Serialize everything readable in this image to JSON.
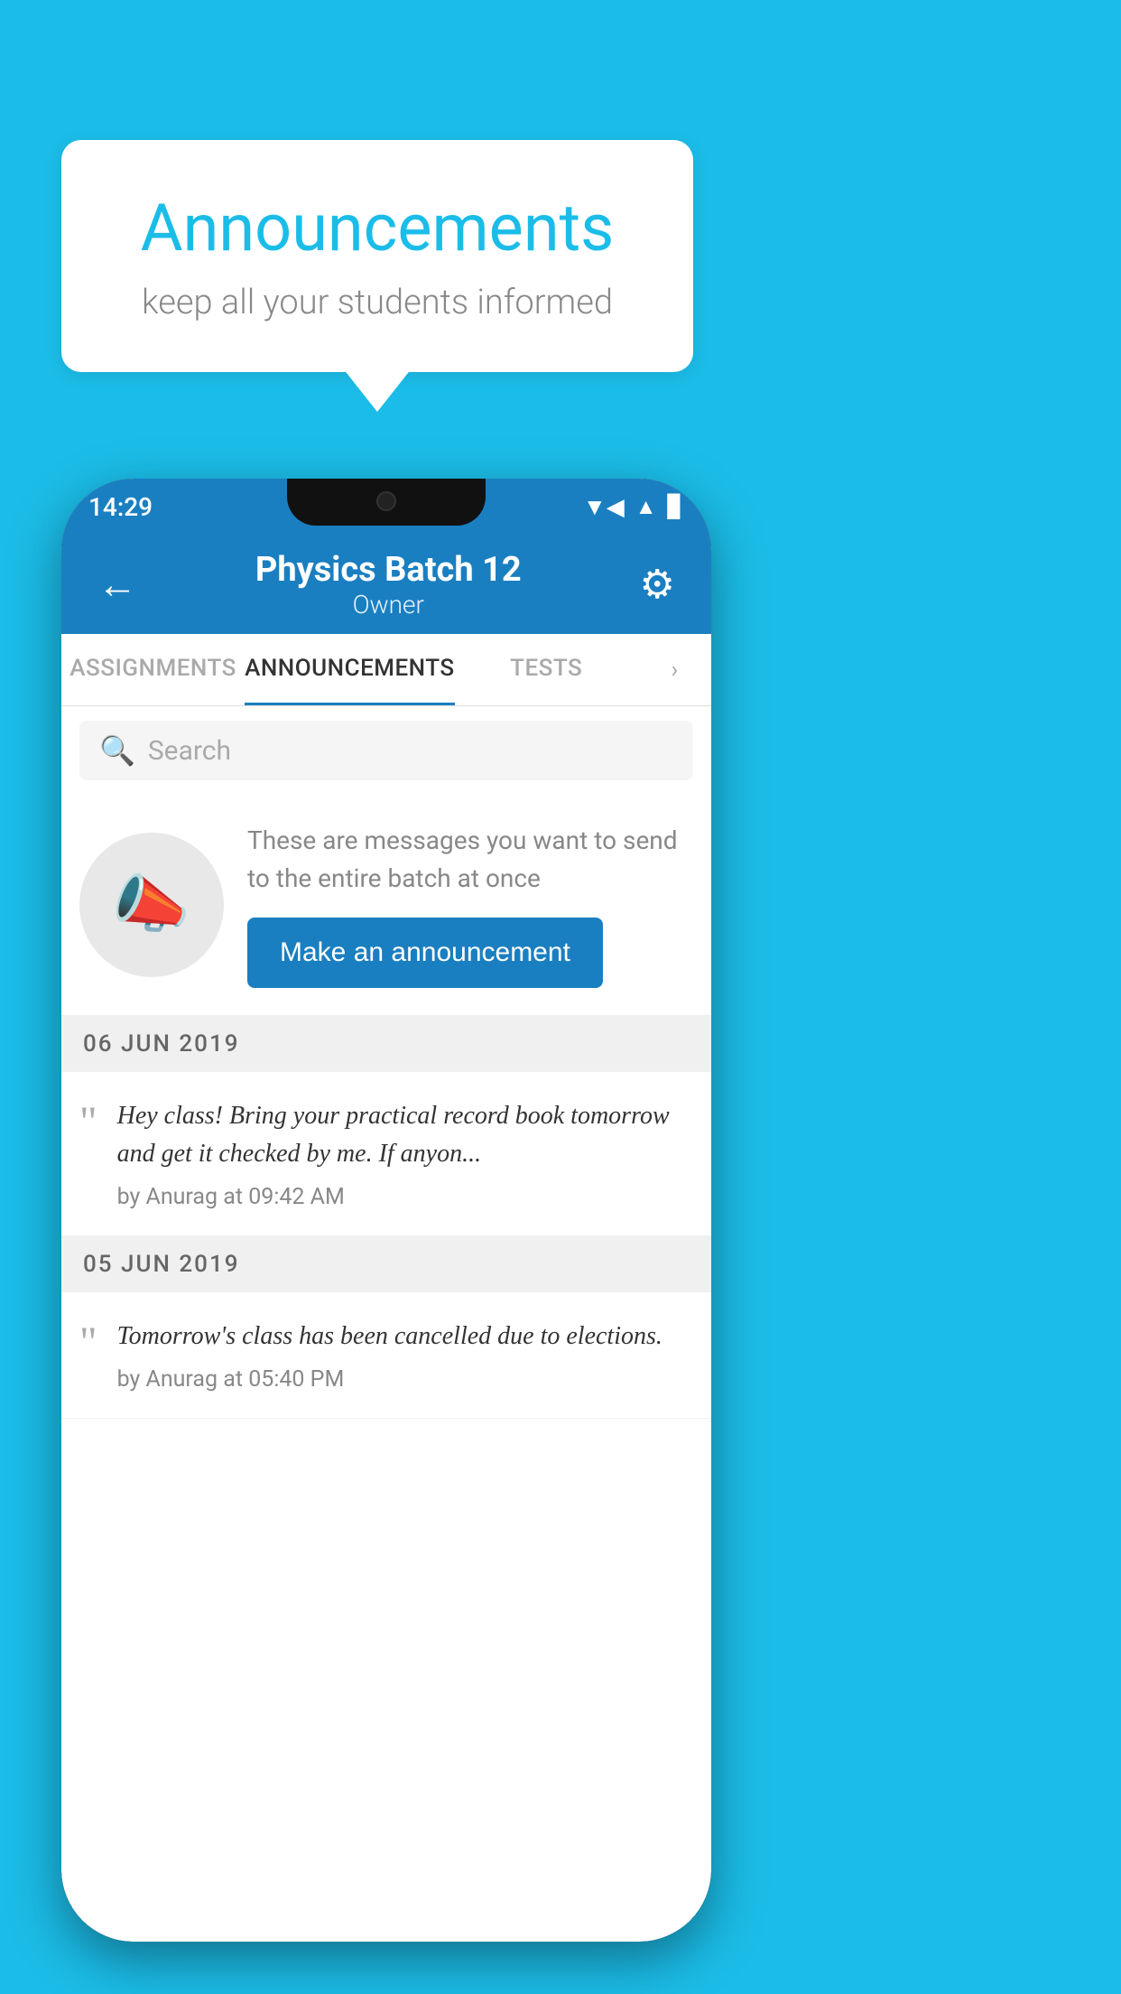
{
  "page": {
    "background_color": "#1BBDE8"
  },
  "speech_bubble": {
    "title": "Announcements",
    "subtitle": "keep all your students informed"
  },
  "status_bar": {
    "time": "14:29",
    "wifi_icon": "wifi",
    "signal_icon": "signal",
    "battery_icon": "battery"
  },
  "header": {
    "back_label": "←",
    "title": "Physics Batch 12",
    "subtitle": "Owner",
    "gear_icon": "⚙"
  },
  "tabs": [
    {
      "label": "ASSIGNMENTS",
      "active": false
    },
    {
      "label": "ANNOUNCEMENTS",
      "active": true
    },
    {
      "label": "TESTS",
      "active": false
    },
    {
      "label": "›",
      "active": false
    }
  ],
  "search": {
    "placeholder": "Search",
    "search_icon": "🔍"
  },
  "promo": {
    "description": "These are messages you want to send to the entire batch at once",
    "button_label": "Make an announcement",
    "icon": "📣"
  },
  "announcements": [
    {
      "date_header": "06  JUN  2019",
      "message": "Hey class! Bring your practical record book tomorrow and get it checked by me. If anyon...",
      "meta": "by Anurag at 09:42 AM"
    },
    {
      "date_header": "05  JUN  2019",
      "message": "Tomorrow's class has been cancelled due to elections.",
      "meta": "by Anurag at 05:40 PM"
    }
  ]
}
